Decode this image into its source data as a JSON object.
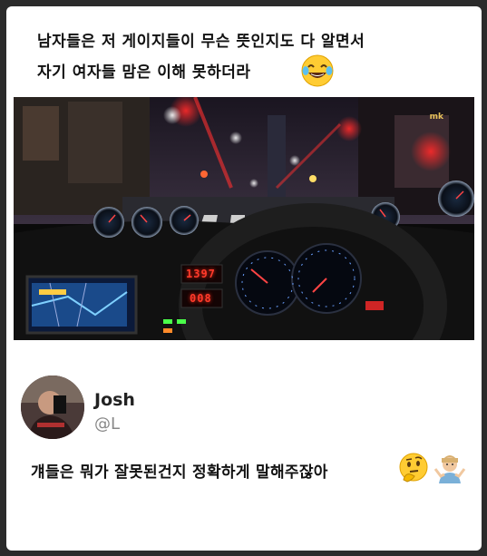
{
  "post": {
    "caption_line1": "남자들은 저 게이지들이 무슨 뜻인지도 다 알면서",
    "caption_line2": "자기 여자들 맘은 이해 못하더라",
    "caption_emoji": "face-with-tears-of-joy-icon"
  },
  "photo": {
    "description_icon": "car-dashboard-night-photo",
    "watermark": "mk",
    "tach_readout": "1397",
    "speed_readout": "008"
  },
  "tweet": {
    "user_name": "Josh",
    "user_handle": "@L",
    "text": "걔들은 뭐가 잘못된건지 정확하게 말해주잖아",
    "emojis": [
      "thinking-face-icon",
      "person-shrugging-icon"
    ]
  },
  "colors": {
    "background": "#2b2b2b",
    "card": "#ffffff",
    "text": "#111111",
    "handle": "#888888",
    "led_red": "#ff3a2a"
  }
}
